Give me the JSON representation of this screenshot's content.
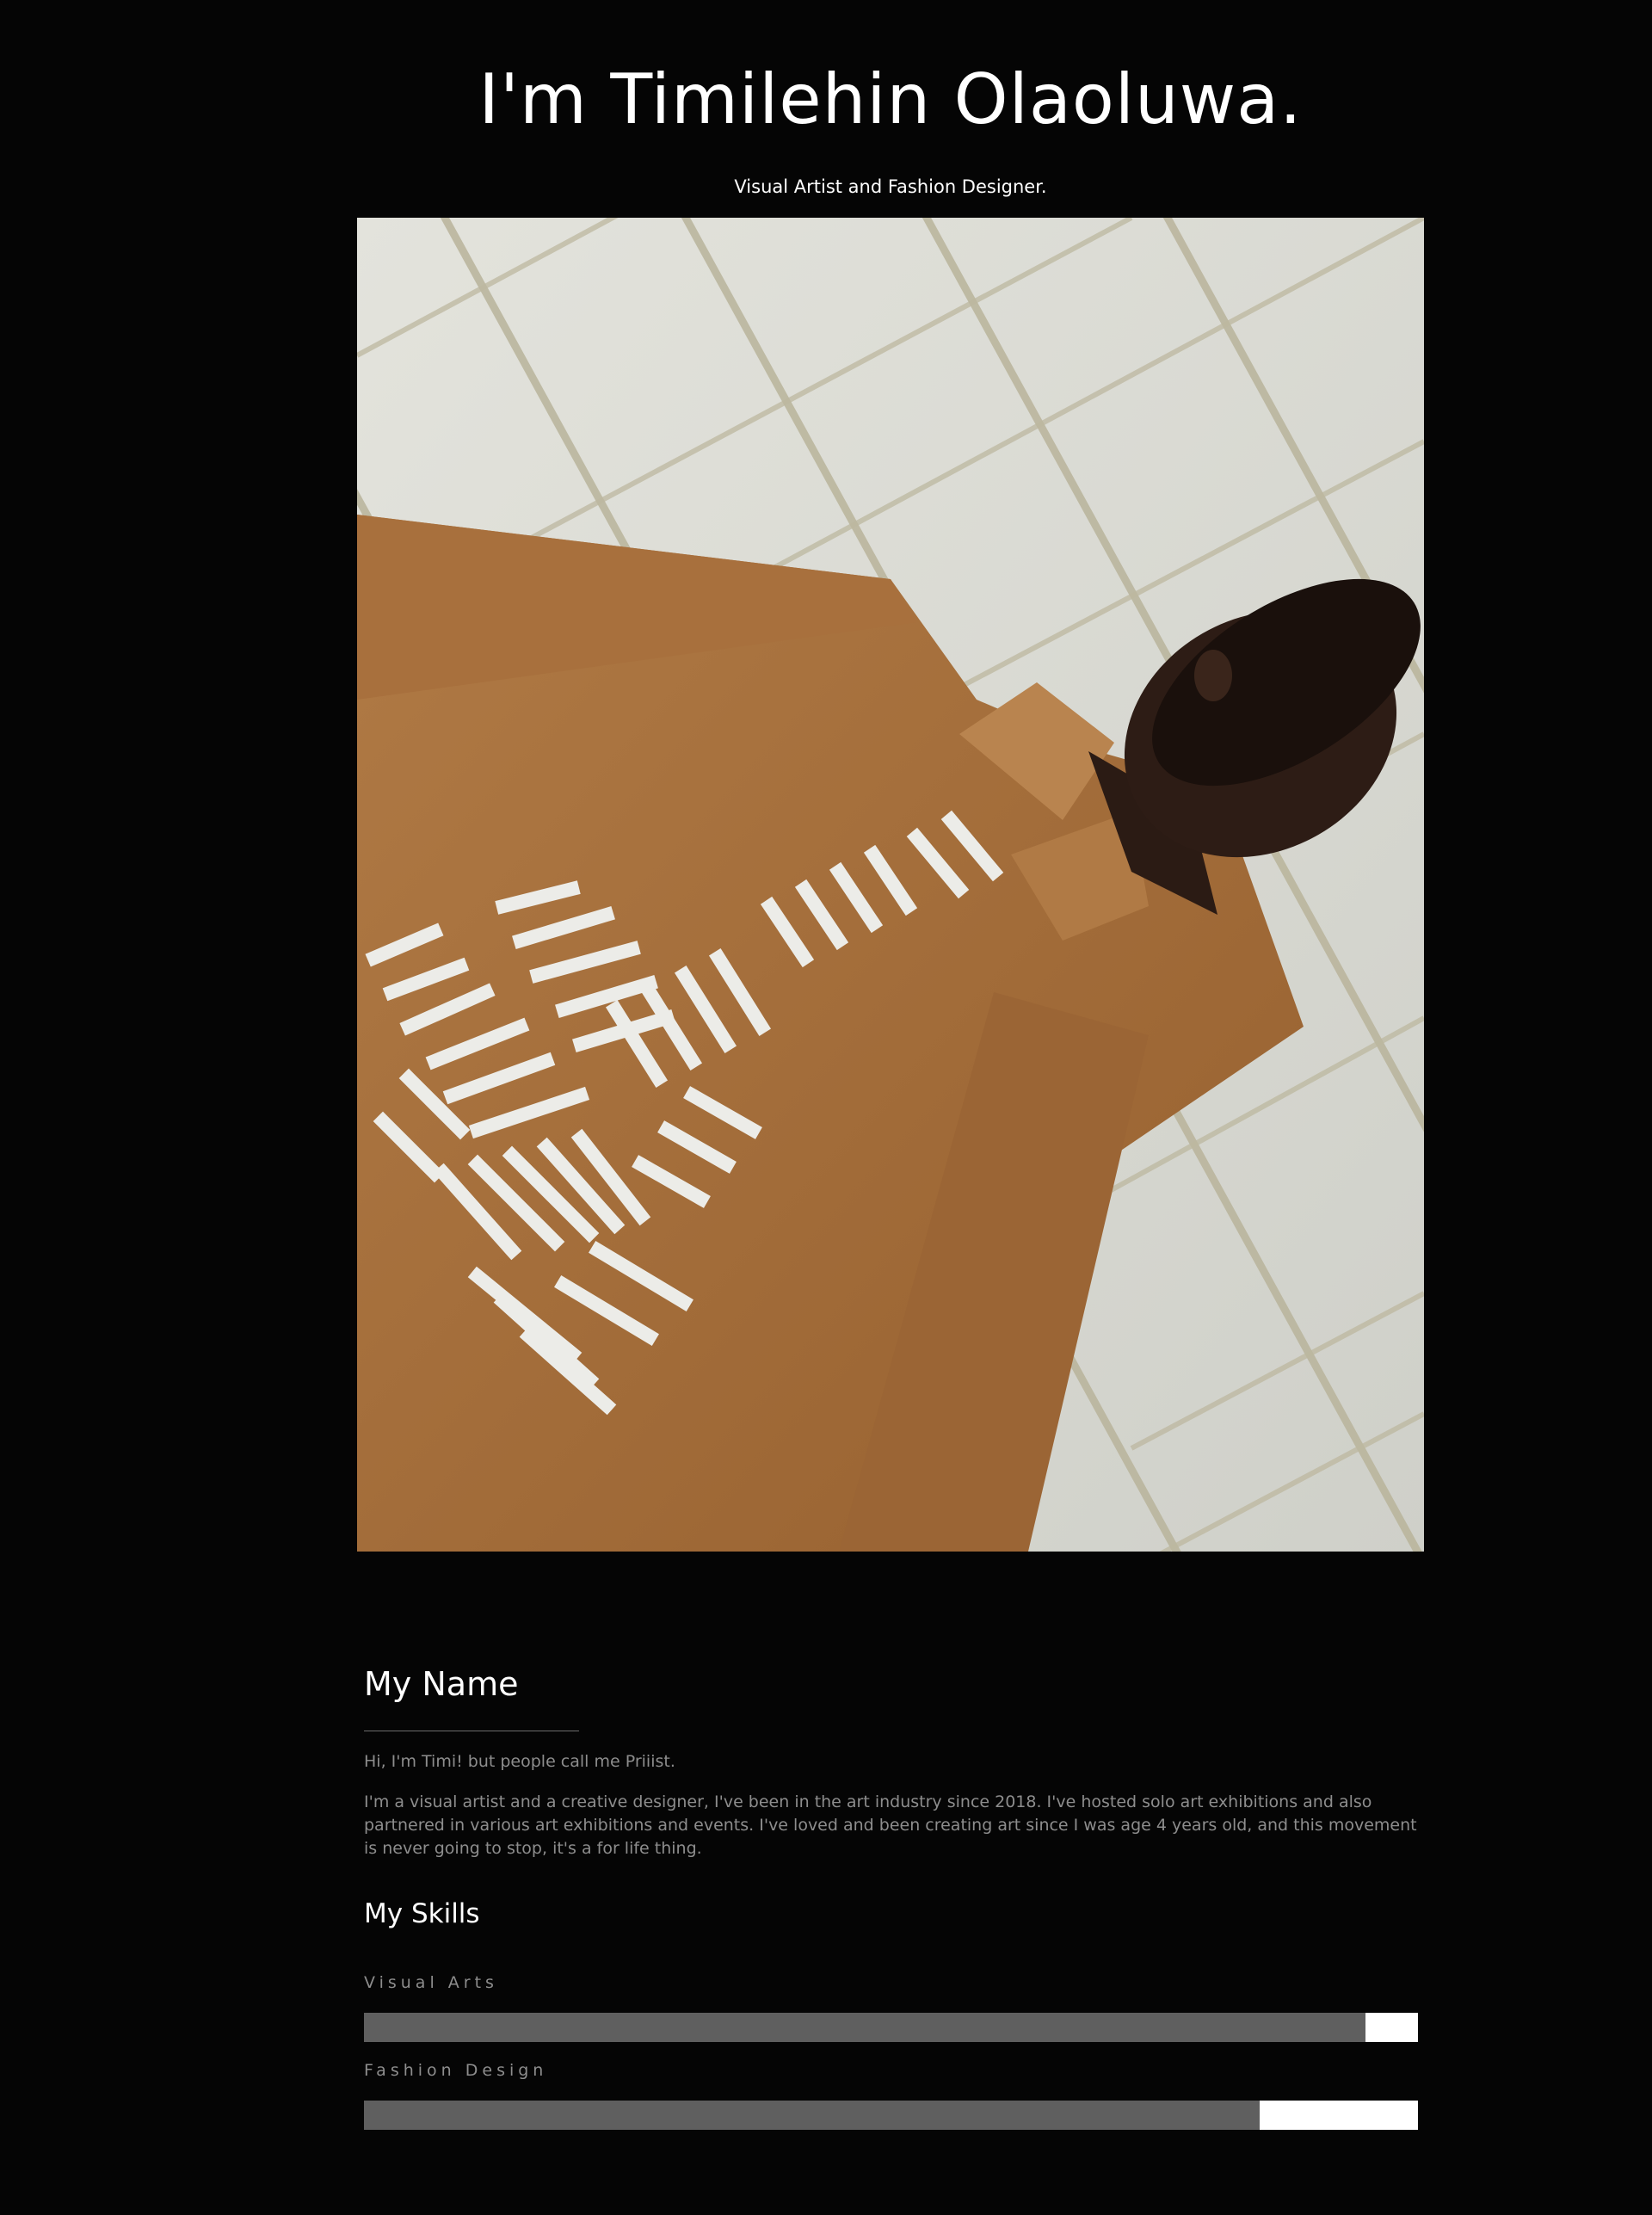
{
  "header": {
    "title": "I'm Timilehin Olaoluwa.",
    "subtitle": "Visual Artist and Fashion Designer."
  },
  "portrait": {
    "icon": "portrait-photo"
  },
  "about": {
    "heading": "My Name",
    "intro": "Hi, I'm Timi! but people call me Priiist.",
    "bio": "I'm a visual artist and a creative designer, I've been in the art industry since 2018. I've hosted solo art exhibitions and also partnered in various art exhibitions and events. I've loved and been creating art since I was age 4 years old, and this movement is never going to stop, it's a for life thing."
  },
  "skills": {
    "heading": "My Skills",
    "items": [
      {
        "label": "Visual Arts",
        "level": 0.95
      },
      {
        "label": "Fashion Design",
        "level": 0.85
      }
    ]
  },
  "colors": {
    "background": "#050505",
    "text": "#ffffff",
    "muted_text": "#8d8d8d",
    "bar_fill": "#5f5f5f",
    "bar_track": "#ffffff"
  }
}
